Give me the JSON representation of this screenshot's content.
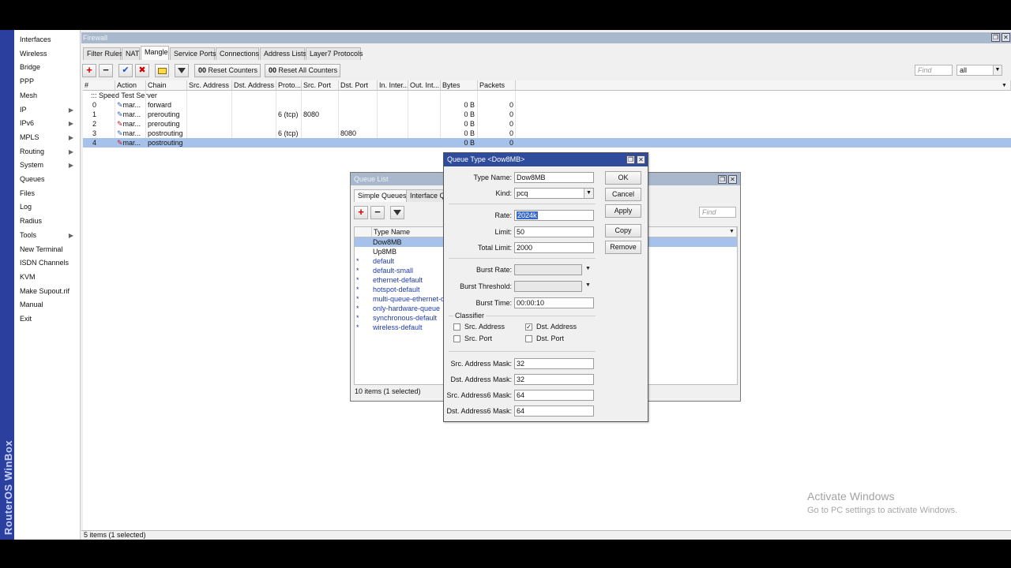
{
  "app": {
    "brand": "RouterOS WinBox"
  },
  "sidebar": {
    "items": [
      {
        "label": "Interfaces",
        "submenu": false
      },
      {
        "label": "Wireless",
        "submenu": false
      },
      {
        "label": "Bridge",
        "submenu": false
      },
      {
        "label": "PPP",
        "submenu": false
      },
      {
        "label": "Mesh",
        "submenu": false
      },
      {
        "label": "IP",
        "submenu": true
      },
      {
        "label": "IPv6",
        "submenu": true
      },
      {
        "label": "MPLS",
        "submenu": true
      },
      {
        "label": "Routing",
        "submenu": true
      },
      {
        "label": "System",
        "submenu": true
      },
      {
        "label": "Queues",
        "submenu": false
      },
      {
        "label": "Files",
        "submenu": false
      },
      {
        "label": "Log",
        "submenu": false
      },
      {
        "label": "Radius",
        "submenu": false
      },
      {
        "label": "Tools",
        "submenu": true
      },
      {
        "label": "New Terminal",
        "submenu": false
      },
      {
        "label": "ISDN Channels",
        "submenu": false
      },
      {
        "label": "KVM",
        "submenu": false
      },
      {
        "label": "Make Supout.rif",
        "submenu": false
      },
      {
        "label": "Manual",
        "submenu": false
      },
      {
        "label": "Exit",
        "submenu": false
      }
    ],
    "submenu_glyph": "▶"
  },
  "firewall": {
    "title": "Firewall",
    "tabs": [
      "Filter Rules",
      "NAT",
      "Mangle",
      "Service Ports",
      "Connections",
      "Address Lists",
      "Layer7 Protocols"
    ],
    "active_tab": "Mangle",
    "toolbar": {
      "reset_counters": "Reset Counters",
      "reset_all_counters": "Reset All Counters",
      "counter_prefix": "00",
      "find_placeholder": "Find",
      "filter_value": "all"
    },
    "columns": [
      "#",
      "Action",
      "Chain",
      "Src. Address",
      "Dst. Address",
      "Proto...",
      "Src. Port",
      "Dst. Port",
      "In. Inter...",
      "Out. Int...",
      "Bytes",
      "Packets"
    ],
    "comment": "::: Speed Test Server",
    "rows": [
      {
        "num": "0",
        "action": "mar...",
        "chain": "forward",
        "proto": "",
        "src_port": "",
        "dst_port": "",
        "bytes": "0 B",
        "packets": "0"
      },
      {
        "num": "1",
        "action": "mar...",
        "chain": "prerouting",
        "proto": "6 (tcp)",
        "src_port": "8080",
        "dst_port": "",
        "bytes": "0 B",
        "packets": "0"
      },
      {
        "num": "2",
        "action": "mar...",
        "chain": "prerouting",
        "proto": "",
        "src_port": "",
        "dst_port": "",
        "bytes": "0 B",
        "packets": "0"
      },
      {
        "num": "3",
        "action": "mar...",
        "chain": "postrouting",
        "proto": "6 (tcp)",
        "src_port": "",
        "dst_port": "8080",
        "bytes": "0 B",
        "packets": "0"
      },
      {
        "num": "4",
        "action": "mar...",
        "chain": "postrouting",
        "proto": "",
        "src_port": "",
        "dst_port": "",
        "bytes": "0 B",
        "packets": "0"
      }
    ],
    "status": "5 items (1 selected)"
  },
  "queue_list": {
    "title": "Queue List",
    "tabs": [
      "Simple Queues",
      "Interface Qu"
    ],
    "find_placeholder": "Find",
    "column": "Type Name",
    "items": [
      {
        "name": "Dow8MB",
        "default": false
      },
      {
        "name": "Up8MB",
        "default": false
      },
      {
        "name": "default",
        "default": true
      },
      {
        "name": "default-small",
        "default": true
      },
      {
        "name": "ethernet-default",
        "default": true
      },
      {
        "name": "hotspot-default",
        "default": true
      },
      {
        "name": "multi-queue-ethernet-def",
        "default": true
      },
      {
        "name": "only-hardware-queue",
        "default": true
      },
      {
        "name": "synchronous-default",
        "default": true
      },
      {
        "name": "wireless-default",
        "default": true
      }
    ],
    "default_marker": "*",
    "status": "10 items (1 selected)"
  },
  "queue_type": {
    "title": "Queue Type <Dow8MB>",
    "labels": {
      "type_name": "Type Name:",
      "kind": "Kind:",
      "rate": "Rate:",
      "limit": "Limit:",
      "total_limit": "Total Limit:",
      "burst_rate": "Burst Rate:",
      "burst_threshold": "Burst Threshold:",
      "burst_time": "Burst Time:",
      "classifier": "Classifier",
      "src_address_mask": "Src. Address Mask:",
      "dst_address_mask": "Dst. Address Mask:",
      "src_address6_mask": "Src. Address6 Mask:",
      "dst_address6_mask": "Dst. Address6 Mask:"
    },
    "values": {
      "type_name": "Dow8MB",
      "kind": "pcq",
      "rate": "2024k",
      "limit": "50",
      "total_limit": "2000",
      "burst_rate": "",
      "burst_threshold": "",
      "burst_time": "00:00:10",
      "src_address_mask": "32",
      "dst_address_mask": "32",
      "src_address6_mask": "64",
      "dst_address6_mask": "64"
    },
    "classifier": {
      "src_address": {
        "label": "Src. Address",
        "checked": false
      },
      "dst_address": {
        "label": "Dst. Address",
        "checked": true
      },
      "src_port": {
        "label": "Src. Port",
        "checked": false
      },
      "dst_port": {
        "label": "Dst. Port",
        "checked": false
      }
    },
    "buttons": {
      "ok": "OK",
      "cancel": "Cancel",
      "apply": "Apply",
      "copy": "Copy",
      "remove": "Remove"
    }
  },
  "watermark": {
    "line1": "Activate Windows",
    "line2": "Go to PC settings to activate Windows."
  },
  "colors": {
    "brand_bar": "#2a3f9e",
    "dialog_title": "#2f4b9c",
    "inactive_title": "#a9b8cc",
    "selection": "#a7c2ea"
  }
}
